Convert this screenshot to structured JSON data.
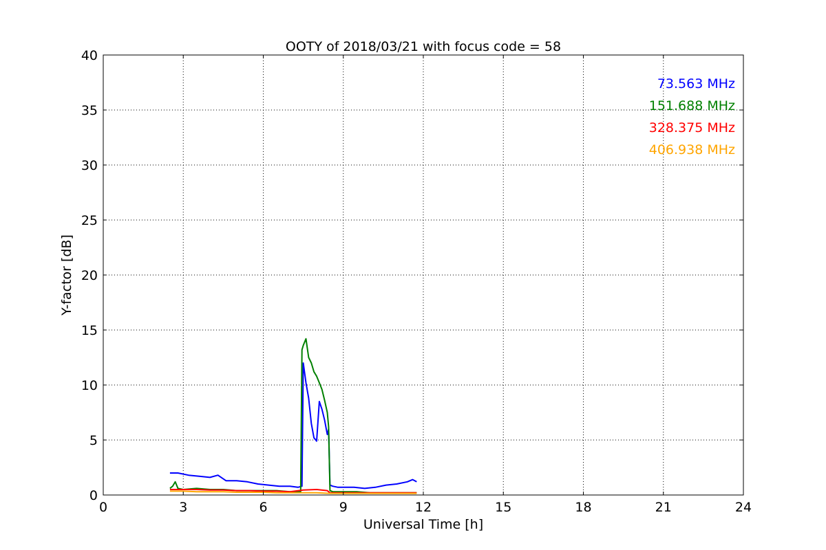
{
  "chart_data": {
    "type": "line",
    "title": "OOTY of 2018/03/21 with focus code = 58",
    "xlabel": "Universal Time [h]",
    "ylabel": "Y-factor [dB]",
    "xlim": [
      0,
      24
    ],
    "ylim": [
      0,
      40
    ],
    "xticks": [
      0,
      3,
      6,
      9,
      12,
      15,
      18,
      21,
      24
    ],
    "yticks": [
      0,
      5,
      10,
      15,
      20,
      25,
      30,
      35,
      40
    ],
    "grid": true,
    "legend_placement": "top-right",
    "series": [
      {
        "name": "73.563 MHz",
        "color": "#0000ff",
        "x": [
          2.5,
          2.8,
          3.2,
          3.6,
          4.0,
          4.3,
          4.6,
          5.0,
          5.4,
          5.8,
          6.2,
          6.6,
          7.0,
          7.3,
          7.45,
          7.5,
          7.6,
          7.7,
          7.8,
          7.9,
          8.0,
          8.1,
          8.2,
          8.3,
          8.4,
          8.45,
          8.5,
          8.6,
          8.8,
          9.0,
          9.4,
          9.8,
          10.2,
          10.6,
          11.0,
          11.4,
          11.6,
          11.75
        ],
        "y": [
          2.0,
          2.0,
          1.8,
          1.7,
          1.6,
          1.8,
          1.3,
          1.3,
          1.2,
          1.0,
          0.9,
          0.8,
          0.8,
          0.7,
          0.8,
          12.0,
          10.2,
          8.8,
          6.5,
          5.2,
          4.9,
          8.5,
          7.8,
          6.8,
          5.5,
          6.0,
          0.9,
          0.8,
          0.7,
          0.7,
          0.7,
          0.6,
          0.7,
          0.9,
          1.0,
          1.2,
          1.4,
          1.2
        ]
      },
      {
        "name": "151.688 MHz",
        "color": "#008000",
        "x": [
          2.5,
          2.6,
          2.7,
          2.8,
          3.0,
          3.5,
          4.0,
          4.5,
          5.0,
          5.5,
          6.0,
          6.5,
          7.0,
          7.4,
          7.45,
          7.5,
          7.6,
          7.7,
          7.8,
          7.9,
          8.0,
          8.1,
          8.2,
          8.3,
          8.4,
          8.45,
          8.5,
          8.6,
          9.0,
          9.5,
          10.0,
          10.5,
          11.0,
          11.5,
          11.75
        ],
        "y": [
          0.6,
          0.8,
          1.2,
          0.6,
          0.5,
          0.6,
          0.5,
          0.5,
          0.4,
          0.4,
          0.4,
          0.4,
          0.3,
          0.3,
          13.2,
          13.6,
          14.2,
          12.5,
          12.0,
          11.2,
          10.8,
          10.2,
          9.6,
          8.6,
          7.5,
          6.2,
          0.4,
          0.3,
          0.3,
          0.3,
          0.2,
          0.2,
          0.2,
          0.2,
          0.2
        ]
      },
      {
        "name": "328.375 MHz",
        "color": "#ff0000",
        "x": [
          2.5,
          3.0,
          3.5,
          4.0,
          4.5,
          5.0,
          5.5,
          6.0,
          6.5,
          7.0,
          7.5,
          8.0,
          8.4,
          8.5,
          9.0,
          9.5,
          10.0,
          10.5,
          11.0,
          11.5,
          11.75
        ],
        "y": [
          0.5,
          0.5,
          0.5,
          0.45,
          0.45,
          0.4,
          0.4,
          0.35,
          0.35,
          0.3,
          0.45,
          0.5,
          0.4,
          0.2,
          0.2,
          0.2,
          0.2,
          0.2,
          0.2,
          0.2,
          0.2
        ]
      },
      {
        "name": "406.938 MHz",
        "color": "#ffa500",
        "x": [
          2.5,
          3.0,
          3.5,
          4.0,
          4.5,
          5.0,
          5.5,
          6.0,
          6.5,
          7.0,
          7.5,
          8.0,
          8.5,
          9.0,
          9.5,
          10.0,
          10.5,
          11.0,
          11.5,
          11.75
        ],
        "y": [
          0.35,
          0.35,
          0.3,
          0.3,
          0.3,
          0.25,
          0.25,
          0.25,
          0.2,
          0.2,
          0.2,
          0.2,
          0.15,
          0.15,
          0.15,
          0.15,
          0.15,
          0.15,
          0.15,
          0.15
        ]
      }
    ]
  }
}
